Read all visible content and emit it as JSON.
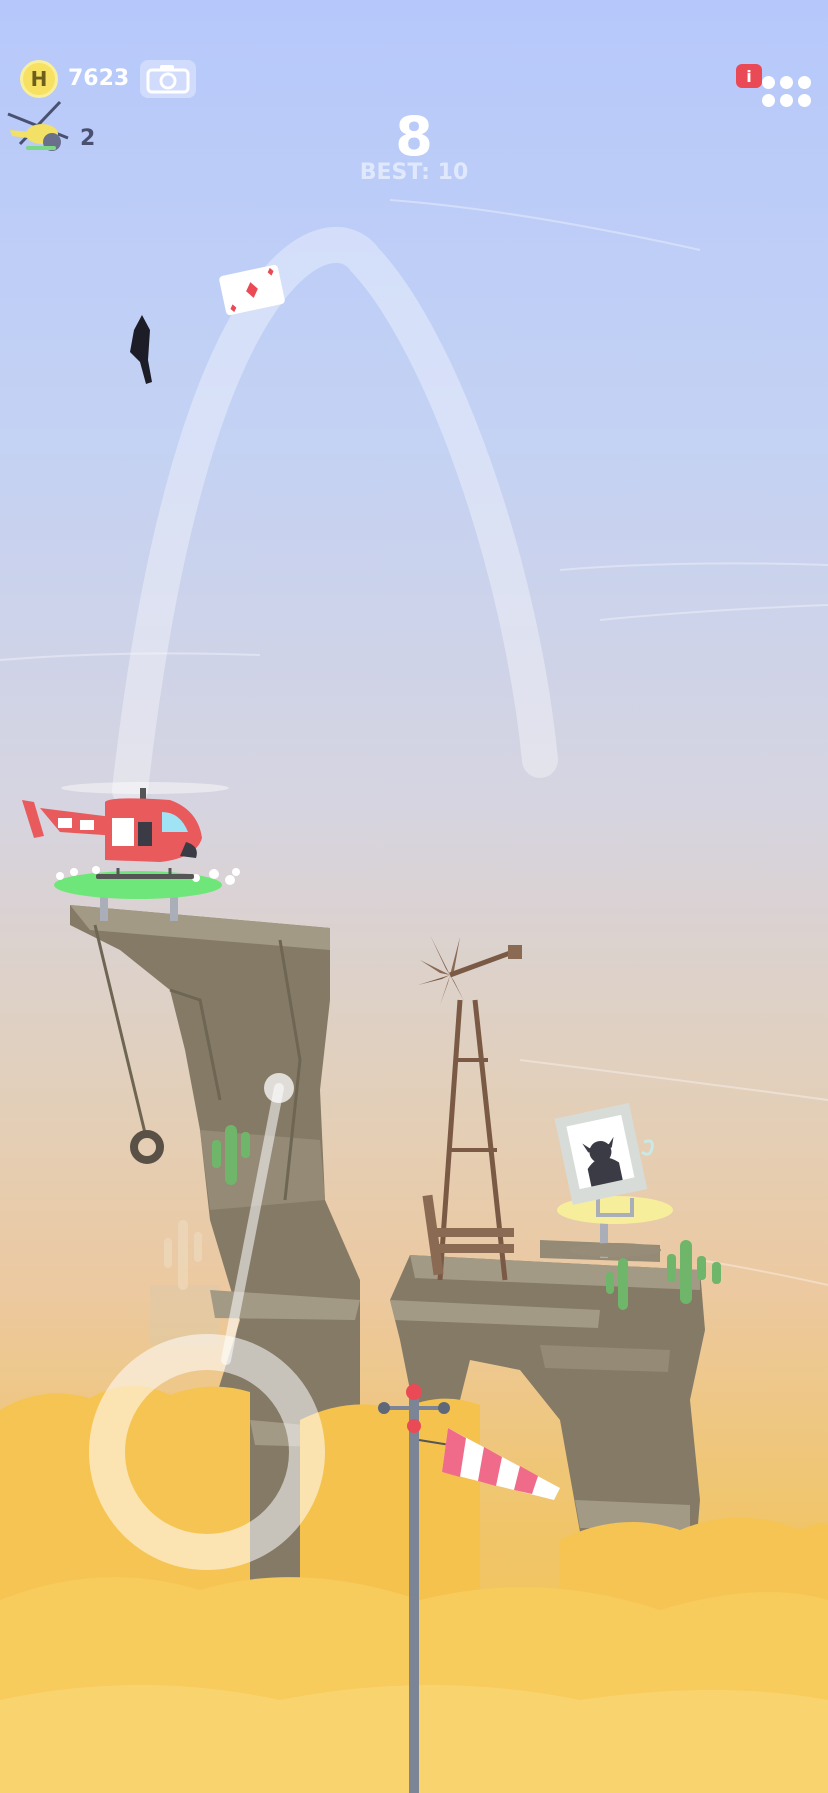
{
  "hud": {
    "coin_letter": "H",
    "coins": "7623",
    "helicopters_left": "2",
    "score": "8",
    "best": "BEST: 10",
    "info_badge": "i"
  },
  "colors": {
    "coin": "#f6e163",
    "info_badge": "#e94a55",
    "helicopter_body": "#e85a5c",
    "landing_pad": "#6fe67a",
    "target_pad": "#f7ee9b",
    "rock": "#857a66",
    "windsock": "#f06a8a"
  },
  "icons": {
    "coin": "coin-icon",
    "camera": "camera-icon",
    "lives": "mini-helicopter-icon",
    "menu": "dots-menu-icon"
  }
}
